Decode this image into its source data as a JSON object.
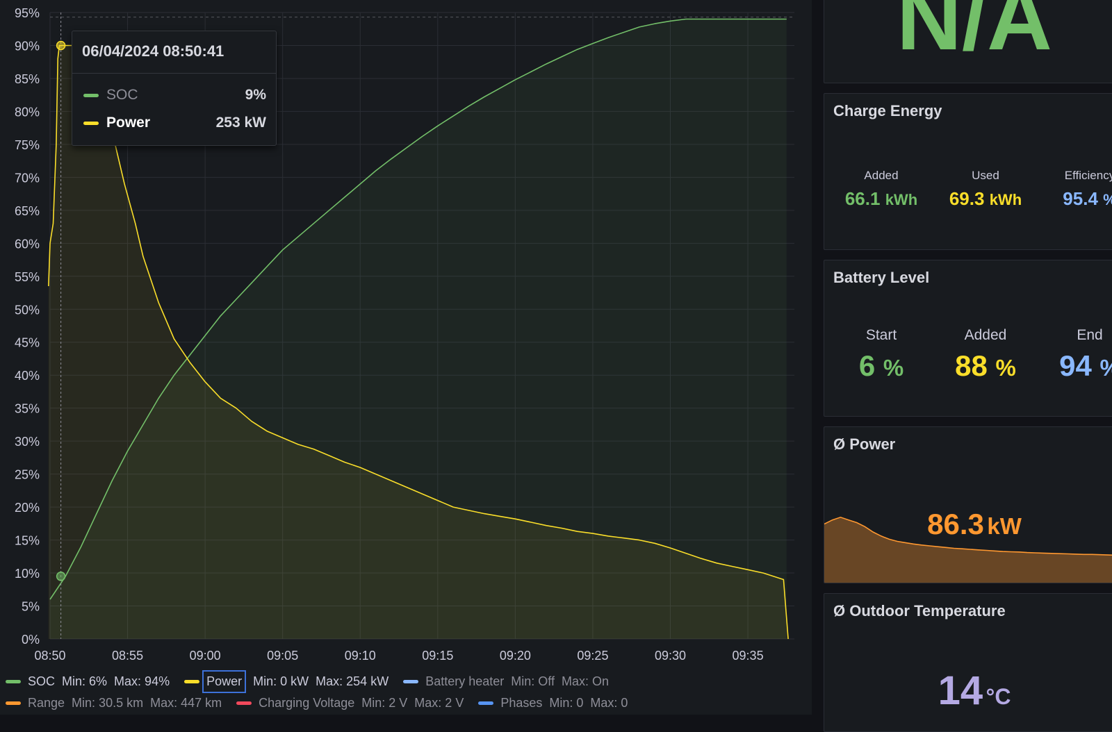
{
  "tooltip": {
    "time": "06/04/2024 08:50:41",
    "rows": [
      {
        "name": "SOC",
        "value": "9%",
        "color": "#73bf69"
      },
      {
        "name": "Power",
        "value": "253 kW",
        "color": "#fade2a"
      }
    ]
  },
  "legend": {
    "row1": [
      {
        "name": "SOC",
        "min": "Min: 6%",
        "max": "Max: 94%",
        "color": "#73bf69",
        "dim": false
      },
      {
        "name": "Power",
        "min": "Min: 0 kW",
        "max": "Max: 254 kW",
        "color": "#fade2a",
        "dim": false
      },
      {
        "name": "Battery heater",
        "min": "Min: Off",
        "max": "Max: On",
        "color": "#8ab8ff",
        "dim": true
      }
    ],
    "row2": [
      {
        "name": "Range",
        "min": "Min: 30.5 km",
        "max": "Max: 447 km",
        "color": "#ff9830",
        "dim": true
      },
      {
        "name": "Charging Voltage",
        "min": "Min: 2 V",
        "max": "Max: 2 V",
        "color": "#f2495c",
        "dim": true
      },
      {
        "name": "Phases",
        "min": "Min: 0",
        "max": "Max: 0",
        "color": "#5794f2",
        "dim": true
      }
    ]
  },
  "top_stat": {
    "value": "N/A",
    "color": "#73bf69"
  },
  "charge_energy": {
    "title": "Charge Energy",
    "added_label": "Added",
    "added_value": "66.1",
    "added_unit": "kWh",
    "used_label": "Used",
    "used_value": "69.3",
    "used_unit": "kWh",
    "eff_label": "Efficiency",
    "eff_value": "95.4",
    "eff_unit": "%"
  },
  "battery_level": {
    "title": "Battery Level",
    "start_label": "Start",
    "start_value": "6",
    "start_unit": "%",
    "added_label": "Added",
    "added_value": "88",
    "added_unit": "%",
    "end_label": "End",
    "end_value": "94",
    "end_unit": "%"
  },
  "avg_power": {
    "title": "Ø Power",
    "value": "86.3",
    "unit": "kW",
    "color": "#ff9830",
    "sparkline": [
      225,
      240,
      250,
      240,
      230,
      215,
      195,
      180,
      168,
      160,
      155,
      150,
      146,
      143,
      140,
      137,
      134,
      132,
      130,
      128,
      126,
      124,
      122,
      121,
      120,
      118,
      117,
      116,
      115,
      114,
      113,
      112,
      111,
      111,
      110,
      109,
      108,
      107
    ]
  },
  "avg_temp": {
    "title": "Ø Outdoor Temperature",
    "value": "14",
    "unit": "°C",
    "color": "#b4a9e3"
  },
  "colors": {
    "soc": "#73bf69",
    "power": "#fade2a",
    "panel_bg": "#181b1f",
    "grid": "#2b2e35",
    "axis_text": "#ccccdc",
    "blue": "#8ab8ff",
    "yellow": "#fade2a",
    "green": "#73bf69"
  },
  "chart_data": {
    "type": "line",
    "x_ticks": [
      "08:50",
      "08:55",
      "09:00",
      "09:05",
      "09:10",
      "09:15",
      "09:20",
      "09:25",
      "09:30",
      "09:35"
    ],
    "y_ticks": [
      "0%",
      "5%",
      "10%",
      "15%",
      "20%",
      "25%",
      "30%",
      "35%",
      "40%",
      "45%",
      "50%",
      "55%",
      "60%",
      "65%",
      "70%",
      "75%",
      "80%",
      "85%",
      "90%",
      "95%"
    ],
    "ylim": [
      0,
      95
    ],
    "xlim_minutes": [
      0,
      48
    ],
    "hover_minute": 0.7,
    "series": [
      {
        "name": "SOC",
        "color": "#73bf69",
        "points": [
          [
            0,
            6
          ],
          [
            1,
            9.5
          ],
          [
            2,
            14
          ],
          [
            3,
            19
          ],
          [
            4,
            24
          ],
          [
            5,
            28.5
          ],
          [
            6,
            32.5
          ],
          [
            7,
            36.5
          ],
          [
            8,
            40
          ],
          [
            9,
            43
          ],
          [
            10,
            46
          ],
          [
            11,
            49
          ],
          [
            12,
            51.5
          ],
          [
            13,
            54
          ],
          [
            14,
            56.5
          ],
          [
            15,
            59
          ],
          [
            16,
            61
          ],
          [
            17,
            63
          ],
          [
            18,
            65
          ],
          [
            19,
            67
          ],
          [
            20,
            69
          ],
          [
            21,
            71
          ],
          [
            22,
            72.8
          ],
          [
            23,
            74.5
          ],
          [
            24,
            76.2
          ],
          [
            25,
            77.8
          ],
          [
            26,
            79.3
          ],
          [
            27,
            80.8
          ],
          [
            28,
            82.2
          ],
          [
            29,
            83.5
          ],
          [
            30,
            84.8
          ],
          [
            31,
            86
          ],
          [
            32,
            87.2
          ],
          [
            33,
            88.3
          ],
          [
            34,
            89.4
          ],
          [
            35,
            90.3
          ],
          [
            36,
            91.2
          ],
          [
            37,
            92
          ],
          [
            38,
            92.8
          ],
          [
            39,
            93.3
          ],
          [
            40,
            93.7
          ],
          [
            41,
            94
          ],
          [
            47.5,
            94
          ]
        ]
      },
      {
        "name": "Power",
        "color": "#fade2a",
        "points": [
          [
            -0.1,
            53.5
          ],
          [
            0,
            60
          ],
          [
            0.2,
            63
          ],
          [
            0.4,
            75
          ],
          [
            0.5,
            88
          ],
          [
            0.6,
            90
          ],
          [
            1.3,
            90
          ],
          [
            2,
            90
          ],
          [
            3,
            85
          ],
          [
            3.8,
            79
          ],
          [
            4.3,
            74
          ],
          [
            4.8,
            69
          ],
          [
            5.5,
            63
          ],
          [
            6,
            58
          ],
          [
            7,
            51
          ],
          [
            8,
            45.5
          ],
          [
            9,
            42
          ],
          [
            10,
            39
          ],
          [
            11,
            36.5
          ],
          [
            12,
            35
          ],
          [
            13,
            33
          ],
          [
            14,
            31.5
          ],
          [
            15,
            30.5
          ],
          [
            16,
            29.5
          ],
          [
            17,
            28.8
          ],
          [
            18,
            27.8
          ],
          [
            19,
            26.8
          ],
          [
            20,
            26
          ],
          [
            21,
            25
          ],
          [
            22,
            24
          ],
          [
            23,
            23
          ],
          [
            24,
            22
          ],
          [
            25,
            21
          ],
          [
            26,
            20
          ],
          [
            27,
            19.5
          ],
          [
            28,
            19
          ],
          [
            29,
            18.6
          ],
          [
            30,
            18.2
          ],
          [
            31,
            17.7
          ],
          [
            32,
            17.2
          ],
          [
            33,
            16.8
          ],
          [
            34,
            16.3
          ],
          [
            35,
            16
          ],
          [
            36,
            15.6
          ],
          [
            37,
            15.3
          ],
          [
            38,
            15
          ],
          [
            39,
            14.5
          ],
          [
            40,
            13.8
          ],
          [
            41,
            13
          ],
          [
            42,
            12.2
          ],
          [
            43,
            11.5
          ],
          [
            44,
            11
          ],
          [
            45,
            10.5
          ],
          [
            46,
            10
          ],
          [
            47.3,
            9
          ],
          [
            47.6,
            0
          ]
        ]
      }
    ]
  }
}
